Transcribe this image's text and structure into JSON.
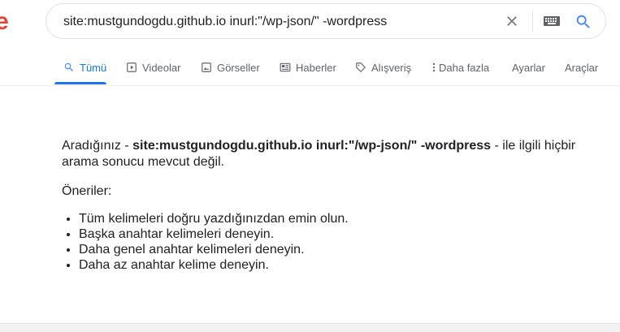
{
  "search": {
    "query": "site:mustgundogdu.github.io inurl:\"/wp-json/\" -wordpress"
  },
  "tabs": [
    {
      "label": "Tümü",
      "icon": "search-icon",
      "active": true
    },
    {
      "label": "Videolar",
      "icon": "video-icon"
    },
    {
      "label": "Görseller",
      "icon": "image-icon"
    },
    {
      "label": "Haberler",
      "icon": "news-icon"
    },
    {
      "label": "Alışveriş",
      "icon": "shopping-tag-icon"
    },
    {
      "label": "Daha fazla",
      "icon": "more-vert-icon"
    },
    {
      "label": "Ayarlar"
    },
    {
      "label": "Araçlar"
    }
  ],
  "results": {
    "no_results_prefix": "Aradığınız - ",
    "no_results_query": "site:mustgundogdu.github.io inurl:\"/wp-json/\" -wordpress",
    "no_results_suffix": " - ile ilgili hiçbir arama sonucu mevcut değil.",
    "suggestions_title": "Öneriler:",
    "suggestions": [
      "Tüm kelimeleri doğru yazdığınızdan emin olun.",
      "Başka anahtar kelimeleri deneyin.",
      "Daha genel anahtar kelimeleri deneyin.",
      "Daha az anahtar kelime deneyin."
    ]
  },
  "colors": {
    "accent": "#1a73e8",
    "logo_red": "#ea4335",
    "text": "#202124",
    "muted": "#5f6368"
  }
}
